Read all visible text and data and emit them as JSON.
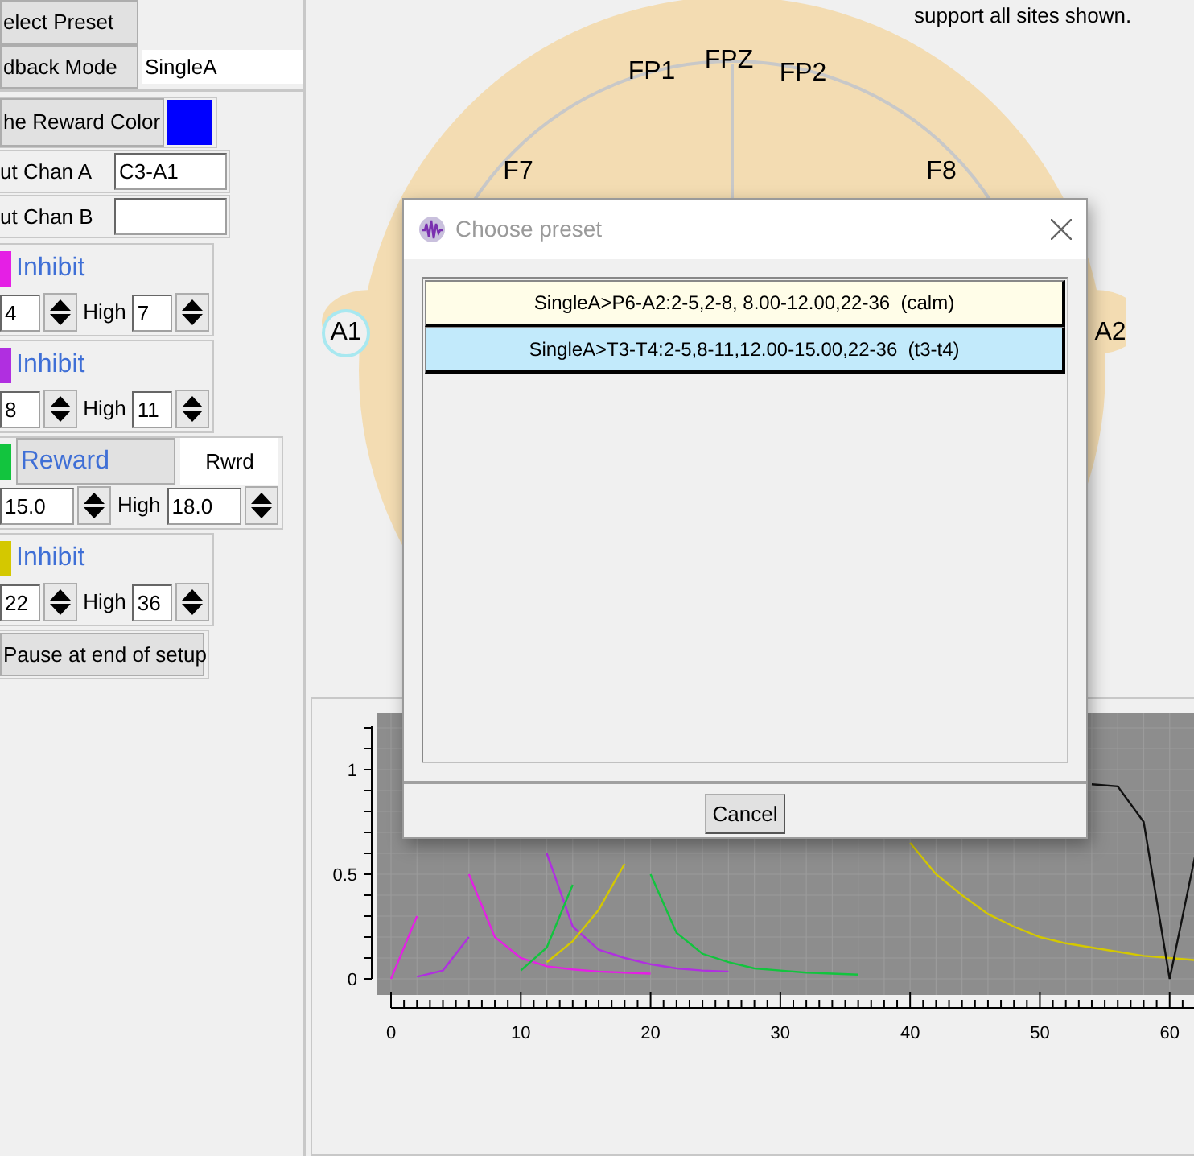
{
  "left_panel": {
    "select_preset_button": "elect Preset",
    "feedback_mode": {
      "label": "dback Mode",
      "value": "SingleA"
    },
    "reward_color": {
      "label": "he Reward Color",
      "color": "#0000ff"
    },
    "input_channels": [
      {
        "label": "ut Chan A",
        "value": "C3-A1"
      },
      {
        "label": "ut Chan B"
      }
    ],
    "bands": [
      {
        "kind": "inhibit",
        "color": "#e51fe5",
        "label": "Inhibit",
        "low": "4",
        "high_label": "High",
        "high": "7"
      },
      {
        "kind": "inhibit",
        "color": "#b02fe0",
        "label": "Inhibit",
        "low": "8",
        "high_label": "High",
        "high": "11"
      },
      {
        "kind": "reward",
        "color": "#12c43e",
        "label": "Reward",
        "tag": "Rwrd",
        "low": "15.0",
        "high_label": "High",
        "high": "18.0"
      },
      {
        "kind": "inhibit",
        "color": "#d4c800",
        "label": "Inhibit",
        "low": "22",
        "high_label": "High",
        "high": "36"
      }
    ],
    "pause_button": "Pause at end of setup"
  },
  "head_map": {
    "note": "support all sites shown.",
    "electrodes": [
      {
        "label": "FP1"
      },
      {
        "label": "FPZ"
      },
      {
        "label": "FP2"
      },
      {
        "label": "F7"
      },
      {
        "label": "F8"
      }
    ],
    "ear_sites": [
      {
        "label": "A1",
        "selected": true
      },
      {
        "label": "A2",
        "selected": false
      }
    ]
  },
  "dialog": {
    "title": "Choose preset",
    "presets": [
      {
        "label": "SingleA>P6-A2:2-5,2-8, 8.00-12.00,22-36  (calm)",
        "selected": false
      },
      {
        "label": "SingleA>T3-T4:2-5,8-11,12.00-15.00,22-36  (t3-t4)",
        "selected": true
      }
    ],
    "cancel_button": "Cancel"
  },
  "chart": {
    "chart_data": {
      "type": "line",
      "x": [
        0,
        2,
        4,
        6,
        8,
        10,
        12,
        14,
        16,
        18,
        20,
        22,
        24,
        26,
        28,
        30,
        32,
        34,
        36,
        38,
        40,
        42,
        44,
        46,
        48,
        50,
        52,
        54,
        56,
        58,
        60,
        62
      ],
      "xlim": [
        0,
        62
      ],
      "ylim": [
        0,
        1.2
      ],
      "xticks": [
        0,
        10,
        20,
        30,
        40,
        50,
        60
      ],
      "yticks": [
        0,
        0.5,
        1
      ],
      "grid": true,
      "series": [
        {
          "color": "#e51fe5",
          "values": [
            0,
            0.3,
            null,
            0.5,
            0.2,
            0.1,
            0.06,
            0.045,
            0.035,
            0.03,
            0.025,
            null,
            null,
            null,
            null,
            null,
            null,
            null,
            null,
            null,
            null,
            null,
            null,
            null,
            null,
            null,
            null,
            null,
            null,
            null,
            null,
            null
          ]
        },
        {
          "color": "#b02fe0",
          "values": [
            null,
            0.01,
            0.04,
            0.2,
            null,
            null,
            0.6,
            0.25,
            0.14,
            0.1,
            0.07,
            0.05,
            0.04,
            0.035,
            null,
            null,
            null,
            null,
            null,
            null,
            null,
            null,
            null,
            null,
            null,
            null,
            null,
            null,
            null,
            null,
            null,
            null
          ]
        },
        {
          "color": "#12c43e",
          "values": [
            null,
            null,
            null,
            null,
            null,
            0.04,
            0.15,
            0.45,
            null,
            null,
            0.5,
            0.22,
            0.12,
            0.08,
            0.05,
            0.04,
            0.03,
            0.025,
            0.02,
            null,
            null,
            null,
            null,
            null,
            null,
            null,
            null,
            null,
            null,
            null,
            null,
            null
          ]
        },
        {
          "color": "#d4c800",
          "values": [
            null,
            null,
            null,
            null,
            null,
            null,
            0.08,
            0.18,
            0.33,
            0.55,
            null,
            null,
            null,
            null,
            null,
            null,
            null,
            null,
            null,
            null,
            0.65,
            0.5,
            0.4,
            0.31,
            0.25,
            0.2,
            0.17,
            0.15,
            0.13,
            0.11,
            0.1,
            0.09
          ]
        },
        {
          "color": "#111111",
          "values": [
            null,
            null,
            null,
            null,
            null,
            null,
            null,
            null,
            null,
            null,
            null,
            null,
            null,
            null,
            null,
            null,
            null,
            null,
            null,
            null,
            null,
            null,
            null,
            null,
            null,
            null,
            null,
            0.93,
            0.92,
            0.75,
            0,
            0.6
          ]
        }
      ]
    }
  }
}
